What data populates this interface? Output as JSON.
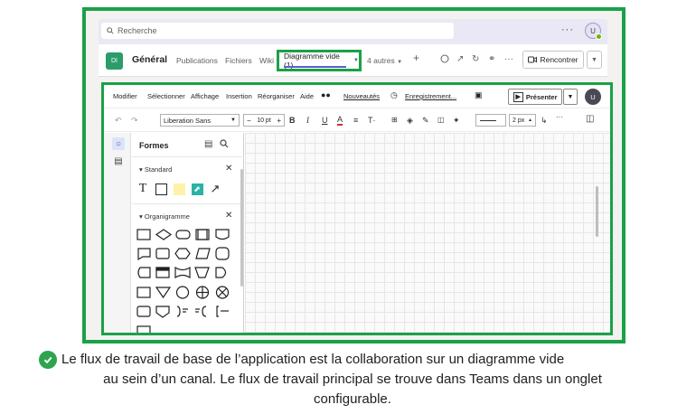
{
  "teams": {
    "search_placeholder": "Recherche",
    "more_dots": "···",
    "user_initial": "U",
    "team_initials": "DI",
    "channel_name": "Général",
    "tabs": [
      "Publications",
      "Fichiers",
      "Wiki"
    ],
    "active_tab": "Diagramme vide (1)",
    "more_tabs": "4 autres",
    "add_tab": "+",
    "meet_label": "Rencontrer"
  },
  "drawio": {
    "menus": [
      "Modifier",
      "Sélectionner",
      "Affichage",
      "Insertion",
      "Réorganiser",
      "Aide"
    ],
    "new_label": "Nouveautés",
    "saving_label": "Enregistrement...",
    "present_label": "Présenter",
    "user_initial": "U",
    "font_name": "Liberation Sans",
    "font_size": "10 pt",
    "line_width": "2 px",
    "shapes_title": "Formes",
    "sections": [
      "Standard",
      "Organigramme"
    ]
  },
  "caption": {
    "lines": [
      "Le flux de travail de base de l’application est la collaboration sur un diagramme vide",
      "au sein d’un canal. Le flux de travail principal se trouve dans Teams dans un onglet",
      "configurable."
    ]
  },
  "colors": {
    "highlight": "#1aa147",
    "check": "#2ea44f",
    "teams_bar": "#e9e8f4",
    "accent": "#5b5fc7"
  }
}
